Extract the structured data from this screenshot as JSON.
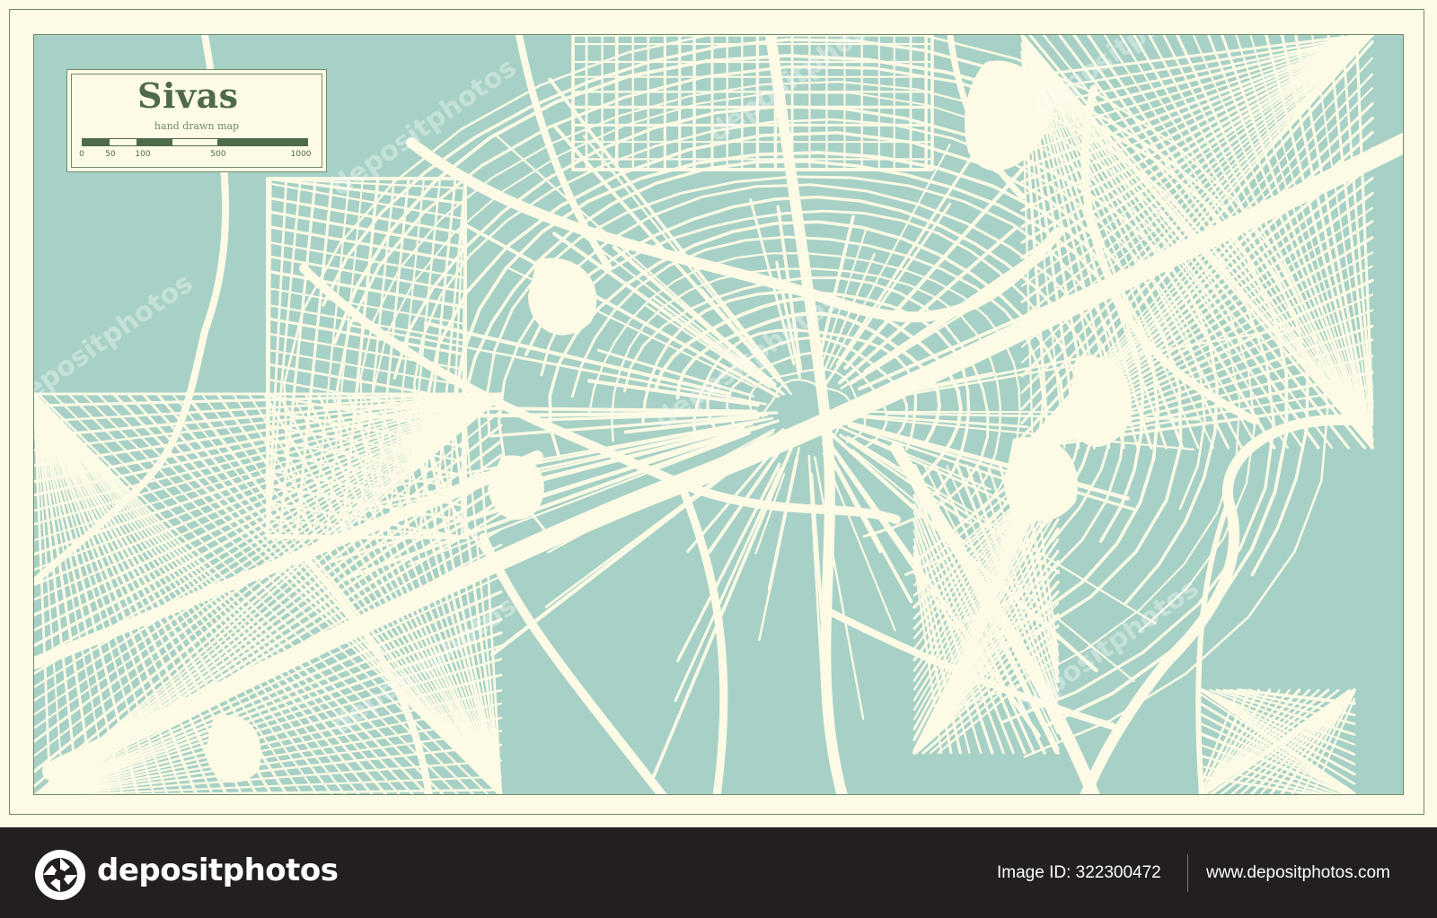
{
  "map": {
    "title": "Sivas",
    "subtitle": "hand drawn map",
    "scale": {
      "ticks": [
        "0",
        "50",
        "100",
        "500",
        "1000"
      ],
      "tick_values": [
        0,
        50,
        100,
        500,
        1000
      ]
    },
    "colors": {
      "land": "#a7d1c6",
      "streets": "#fdfbe6",
      "border": "#6f8b6a",
      "title": "#4f6a4b"
    }
  },
  "watermark": {
    "text": "depositphotos"
  },
  "footer": {
    "brand": "depositphotos",
    "logo_icon": "camera-aperture-icon",
    "image_id": "Image ID: 322300472",
    "site": "www.depositphotos.com",
    "background": "#231f20"
  }
}
